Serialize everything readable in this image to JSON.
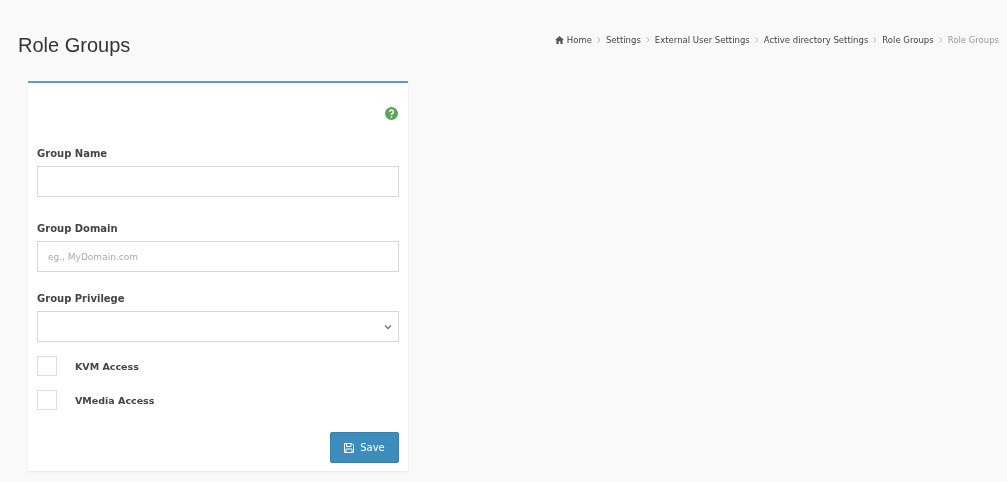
{
  "page_title": "Role Groups",
  "breadcrumb": [
    {
      "label": "Home",
      "current": false
    },
    {
      "label": "Settings",
      "current": false
    },
    {
      "label": "External User Settings",
      "current": false
    },
    {
      "label": "Active directory Settings",
      "current": false
    },
    {
      "label": "Role Groups",
      "current": false
    },
    {
      "label": "Role Groups",
      "current": true
    }
  ],
  "form": {
    "fields": [
      {
        "kind": "text",
        "label": "Group Name"
      },
      {
        "kind": "text",
        "label": "Group Domain",
        "placeholder": "eg., MyDomain.com"
      },
      {
        "kind": "select",
        "label": "Group Privilege"
      }
    ],
    "checkboxes": [
      {
        "label": "KVM Access",
        "checked": false
      },
      {
        "label": "VMedia Access",
        "checked": false
      }
    ],
    "save_button": "Save"
  }
}
